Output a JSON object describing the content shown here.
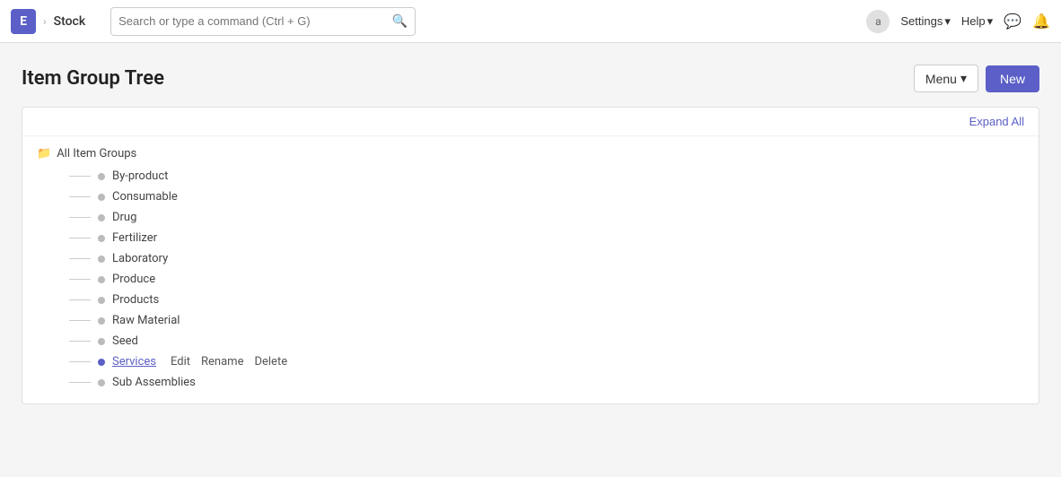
{
  "navbar": {
    "app_letter": "E",
    "breadcrumb_arrow": "›",
    "module": "Stock",
    "search_placeholder": "Search or type a command (Ctrl + G)",
    "avatar_letter": "a",
    "settings_label": "Settings",
    "help_label": "Help"
  },
  "page": {
    "title": "Item Group Tree",
    "menu_label": "Menu",
    "new_label": "New",
    "expand_all_label": "Expand All"
  },
  "tree": {
    "root_label": "All Item Groups",
    "items": [
      {
        "label": "By-product",
        "active": false,
        "context": false
      },
      {
        "label": "Consumable",
        "active": false,
        "context": false
      },
      {
        "label": "Drug",
        "active": false,
        "context": false
      },
      {
        "label": "Fertilizer",
        "active": false,
        "context": false
      },
      {
        "label": "Laboratory",
        "active": false,
        "context": false
      },
      {
        "label": "Produce",
        "active": false,
        "context": false
      },
      {
        "label": "Products",
        "active": false,
        "context": false
      },
      {
        "label": "Raw Material",
        "active": false,
        "context": false
      },
      {
        "label": "Seed",
        "active": false,
        "context": false
      },
      {
        "label": "Services",
        "active": true,
        "context": true
      },
      {
        "label": "Sub Assemblies",
        "active": false,
        "context": false
      }
    ],
    "context_menu": {
      "edit": "Edit",
      "rename": "Rename",
      "delete": "Delete"
    }
  }
}
